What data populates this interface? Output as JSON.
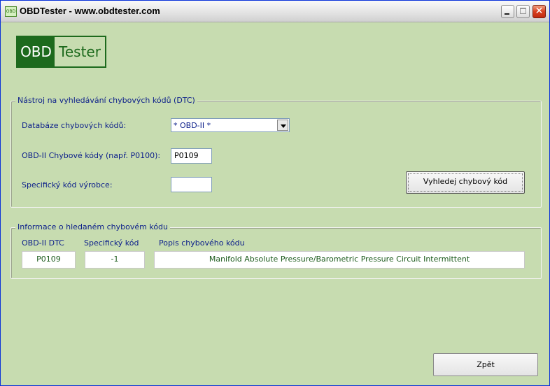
{
  "window": {
    "title": "OBDTester - www.obdtester.com",
    "icon_text": "OBD",
    "accent": "#0831d9",
    "background": "#c7dcb0"
  },
  "logo": {
    "left": "OBD",
    "right": "Tester",
    "color": "#1d6a1d"
  },
  "search_group": {
    "legend": "Nástroj na vyhledávání chybových kódů (DTC)",
    "database_label": "Databáze chybových kódů:",
    "database_value": "* OBD-II *",
    "dtc_label": "OBD-II Chybové kódy (např. P0100):",
    "dtc_value": "P0109",
    "manufacturer_label": "Specifický kód výrobce:",
    "manufacturer_value": "",
    "search_button": "Vyhledej chybový kód"
  },
  "info_group": {
    "legend": "Informace o hledaném chybovém kódu",
    "col_dtc": "OBD-II DTC",
    "col_specific": "Specifický kód",
    "col_description": "Popis chybového kódu",
    "dtc": "P0109",
    "specific": "-1",
    "description": "Manifold Absolute Pressure/Barometric Pressure Circuit Intermittent"
  },
  "back_button": "Zpět"
}
